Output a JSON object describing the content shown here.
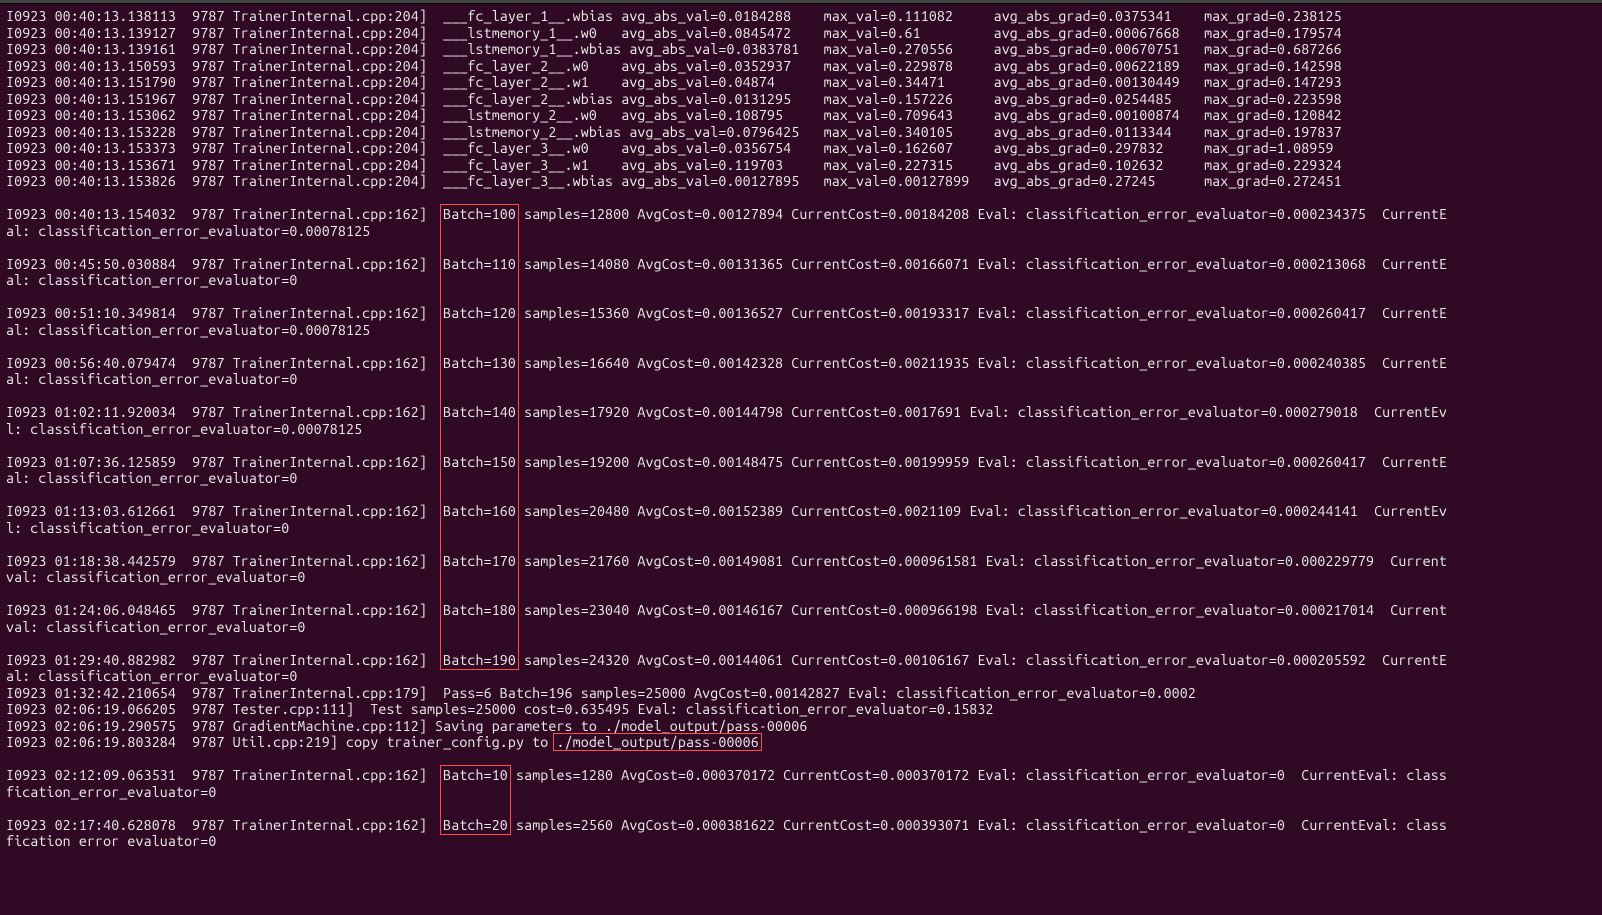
{
  "param_lines": [
    "I0923 00:40:13.138113  9787 TrainerInternal.cpp:204]  ___fc_layer_1__.wbias avg_abs_val=0.0184288    max_val=0.111082     avg_abs_grad=0.0375341    max_grad=0.238125",
    "I0923 00:40:13.139127  9787 TrainerInternal.cpp:204]  ___lstmemory_1__.w0   avg_abs_val=0.0845472    max_val=0.61         avg_abs_grad=0.00067668   max_grad=0.179574",
    "I0923 00:40:13.139161  9787 TrainerInternal.cpp:204]  ___lstmemory_1__.wbias avg_abs_val=0.0383781   max_val=0.270556     avg_abs_grad=0.00670751   max_grad=0.687266",
    "I0923 00:40:13.150593  9787 TrainerInternal.cpp:204]  ___fc_layer_2__.w0    avg_abs_val=0.0352937    max_val=0.229878     avg_abs_grad=0.00622189   max_grad=0.142598",
    "I0923 00:40:13.151790  9787 TrainerInternal.cpp:204]  ___fc_layer_2__.w1    avg_abs_val=0.04874      max_val=0.34471      avg_abs_grad=0.00130449   max_grad=0.147293",
    "I0923 00:40:13.151967  9787 TrainerInternal.cpp:204]  ___fc_layer_2__.wbias avg_abs_val=0.0131295    max_val=0.157226     avg_abs_grad=0.0254485    max_grad=0.223598",
    "I0923 00:40:13.153062  9787 TrainerInternal.cpp:204]  ___lstmemory_2__.w0   avg_abs_val=0.108795     max_val=0.709643     avg_abs_grad=0.00100874   max_grad=0.120842",
    "I0923 00:40:13.153228  9787 TrainerInternal.cpp:204]  ___lstmemory_2__.wbias avg_abs_val=0.0796425   max_val=0.340105     avg_abs_grad=0.0113344    max_grad=0.197837",
    "I0923 00:40:13.153373  9787 TrainerInternal.cpp:204]  ___fc_layer_3__.w0    avg_abs_val=0.0356754    max_val=0.162607     avg_abs_grad=0.297832     max_grad=1.08959",
    "I0923 00:40:13.153671  9787 TrainerInternal.cpp:204]  ___fc_layer_3__.w1    avg_abs_val=0.119703     max_val=0.227315     avg_abs_grad=0.102632     max_grad=0.229324",
    "I0923 00:40:13.153826  9787 TrainerInternal.cpp:204]  ___fc_layer_3__.wbias avg_abs_val=0.00127895   max_val=0.00127899   avg_abs_grad=0.27245      max_grad=0.272451"
  ],
  "batches": [
    {
      "prefix": "I0923 00:40:13.154032  9787 TrainerInternal.cpp:162]  ",
      "batch": "Batch=100",
      "rest": " samples=12800 AvgCost=0.00127894 CurrentCost=0.00184208 Eval: classification_error_evaluator=0.000234375  CurrentE",
      "wrap": "al: classification_error_evaluator=0.00078125"
    },
    {
      "prefix": "I0923 00:45:50.030884  9787 TrainerInternal.cpp:162]  ",
      "batch": "Batch=110",
      "rest": " samples=14080 AvgCost=0.00131365 CurrentCost=0.00166071 Eval: classification_error_evaluator=0.000213068  CurrentE",
      "wrap": "al: classification_error_evaluator=0"
    },
    {
      "prefix": "I0923 00:51:10.349814  9787 TrainerInternal.cpp:162]  ",
      "batch": "Batch=120",
      "rest": " samples=15360 AvgCost=0.00136527 CurrentCost=0.00193317 Eval: classification_error_evaluator=0.000260417  CurrentE",
      "wrap": "al: classification_error_evaluator=0.00078125"
    },
    {
      "prefix": "I0923 00:56:40.079474  9787 TrainerInternal.cpp:162]  ",
      "batch": "Batch=130",
      "rest": " samples=16640 AvgCost=0.00142328 CurrentCost=0.00211935 Eval: classification_error_evaluator=0.000240385  CurrentE",
      "wrap": "al: classification_error_evaluator=0"
    },
    {
      "prefix": "I0923 01:02:11.920034  9787 TrainerInternal.cpp:162]  ",
      "batch": "Batch=140",
      "rest": " samples=17920 AvgCost=0.00144798 CurrentCost=0.0017691 Eval: classification_error_evaluator=0.000279018  CurrentEv",
      "wrap": "l: classification_error_evaluator=0.00078125"
    },
    {
      "prefix": "I0923 01:07:36.125859  9787 TrainerInternal.cpp:162]  ",
      "batch": "Batch=150",
      "rest": " samples=19200 AvgCost=0.00148475 CurrentCost=0.00199959 Eval: classification_error_evaluator=0.000260417  CurrentE",
      "wrap": "al: classification_error_evaluator=0"
    },
    {
      "prefix": "I0923 01:13:03.612661  9787 TrainerInternal.cpp:162]  ",
      "batch": "Batch=160",
      "rest": " samples=20480 AvgCost=0.00152389 CurrentCost=0.0021109 Eval: classification_error_evaluator=0.000244141  CurrentEv",
      "wrap": "l: classification_error_evaluator=0"
    },
    {
      "prefix": "I0923 01:18:38.442579  9787 TrainerInternal.cpp:162]  ",
      "batch": "Batch=170",
      "rest": " samples=21760 AvgCost=0.00149081 CurrentCost=0.000961581 Eval: classification_error_evaluator=0.000229779  Current",
      "wrap": "val: classification_error_evaluator=0"
    },
    {
      "prefix": "I0923 01:24:06.048465  9787 TrainerInternal.cpp:162]  ",
      "batch": "Batch=180",
      "rest": " samples=23040 AvgCost=0.00146167 CurrentCost=0.000966198 Eval: classification_error_evaluator=0.000217014  Current",
      "wrap": "val: classification_error_evaluator=0"
    },
    {
      "prefix": "I0923 01:29:40.882982  9787 TrainerInternal.cpp:162]  ",
      "batch": "Batch=190",
      "rest": " samples=24320 AvgCost=0.00144061 CurrentCost=0.00106167 Eval: classification_error_evaluator=0.000205592  CurrentE",
      "wrap": "al: classification_error_evaluator=0"
    }
  ],
  "tail": [
    "I0923 01:32:42.210654  9787 TrainerInternal.cpp:179]  Pass=6 Batch=196 samples=25000 AvgCost=0.00142827 Eval: classification_error_evaluator=0.0002",
    "I0923 02:06:19.066205  9787 Tester.cpp:111]  Test samples=25000 cost=0.635495 Eval: classification_error_evaluator=0.15832"
  ],
  "save": {
    "prefix": "I0923 02:06:19.290575  9787 GradientMachine.cpp:112] Saving parameters to ./model_output/pass-00006",
    "line2_a": "I0923 02:06:19.803284  9787 Util.cpp:219] copy trainer_config.py to ",
    "line2_b": "./model_output/pass-00006"
  },
  "next_batches": [
    {
      "prefix": "I0923 02:12:09.063531  9787 TrainerInternal.cpp:162]  ",
      "batch": "Batch=10",
      "rest": " samples=1280 AvgCost=0.000370172 CurrentCost=0.000370172 Eval: classification_error_evaluator=0  CurrentEval: class",
      "wrap": "fication_error_evaluator=0"
    },
    {
      "prefix": "I0923 02:17:40.628078  9787 TrainerInternal.cpp:162]  ",
      "batch": "Batch=20",
      "rest": " samples=2560 AvgCost=0.000381622 CurrentCost=0.000393071 Eval: classification_error_evaluator=0  CurrentEval: class",
      "wrap": "fication error evaluator=0"
    }
  ]
}
